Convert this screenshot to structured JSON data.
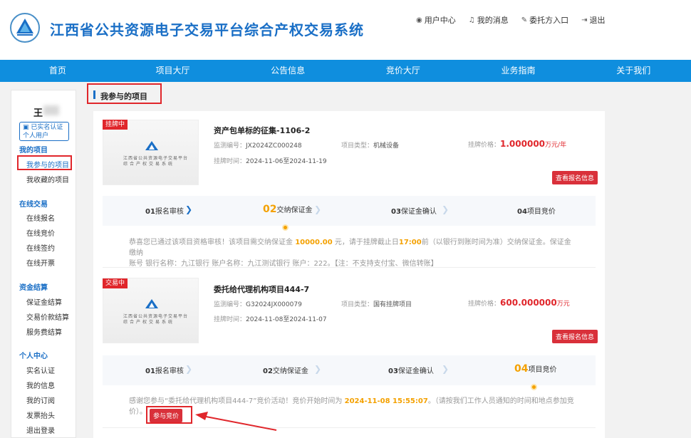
{
  "header": {
    "site_title": "江西省公共资源电子交易平台综合产权交易系统",
    "links": [
      {
        "icon": "user-icon",
        "label": "用户中心"
      },
      {
        "icon": "bell-icon",
        "label": "我的消息"
      },
      {
        "icon": "delegate-icon",
        "label": "委托方入口"
      },
      {
        "icon": "logout-icon",
        "label": "退出"
      }
    ]
  },
  "nav": [
    "首页",
    "项目大厅",
    "公告信息",
    "竞价大厅",
    "业务指南",
    "关于我们"
  ],
  "sidebar": {
    "user_name": "王",
    "badge_line1": "已实名认证",
    "badge_line2": "个人用户",
    "sections": [
      {
        "title": "我的项目",
        "items": [
          "我参与的项目",
          "我收藏的项目"
        ]
      },
      {
        "title": "在线交易",
        "items": [
          "在线报名",
          "在线竞价",
          "在线签约",
          "在线开票"
        ]
      },
      {
        "title": "资金结算",
        "items": [
          "保证金结算",
          "交易价款结算",
          "服务费结算"
        ]
      },
      {
        "title": "个人中心",
        "items": [
          "实名认证",
          "我的信息",
          "我的订阅",
          "发票抬头",
          "退出登录"
        ]
      }
    ]
  },
  "main": {
    "section_title": "我参与的项目",
    "thumb_text1": "江西省公共资源电子交易平台",
    "thumb_text2": "综合产权交易系统",
    "projects": [
      {
        "tag": "挂牌中",
        "title": "资产包单标的征集-1106-2",
        "code_label": "监测编号：",
        "code": "JX2024ZC000248",
        "type_label": "项目类型：",
        "type": "机械设备",
        "price_label": "挂牌价格：",
        "price": "1.000000",
        "unit": "万元/年",
        "time_label": "挂牌时间：",
        "time": "2024-11-06至2024-11-19",
        "view_button": "查看报名信息",
        "steps": [
          {
            "num": "01",
            "label": "报名审核"
          },
          {
            "num": "02",
            "label": "交纳保证金"
          },
          {
            "num": "03",
            "label": "保证金确认"
          },
          {
            "num": "04",
            "label": "项目竞价"
          }
        ],
        "active_step": 2,
        "msg_a": "恭喜您已通过该项目资格审核！该项目需交纳保证金 ",
        "msg_amount": "10000.00",
        "msg_b": " 元，请于挂牌截止日",
        "msg_time": "17:00",
        "msg_c": "前（以银行到账时间为准）交纳保证金。保证金缴纳",
        "msg_line2": "账号  银行名称：九江银行 账户名称：九江测试银行 账户：222。【注：不支持支付宝、微信转账】"
      },
      {
        "tag": "交易中",
        "title": "委托给代理机构项目444-7",
        "code_label": "监测编号：",
        "code": "G32024JX000079",
        "type_label": "项目类型：",
        "type": "国有挂牌项目",
        "price_label": "挂牌价格：",
        "price": "600.000000",
        "unit": "万元",
        "time_label": "挂牌时间：",
        "time": "2024-11-08至2024-11-07",
        "view_button": "查看报名信息",
        "steps": [
          {
            "num": "01",
            "label": "报名审核"
          },
          {
            "num": "02",
            "label": "交纳保证金"
          },
          {
            "num": "03",
            "label": "保证金确认"
          },
          {
            "num": "04",
            "label": "项目竞价"
          }
        ],
        "active_step": 4,
        "msg_a": "感谢您参与“委托给代理机构项目444-7”竞价活动！竞价开始时间为 ",
        "msg_time": "2024-11-08 15:55:07",
        "msg_b": "。（请按我们工作人员通知的时间和地点参加竞",
        "msg_line2": "价）。",
        "bid_button": "参与竞价"
      }
    ]
  },
  "colors": {
    "brand": "#1a6fc6",
    "nav": "#0f8ede",
    "accent": "#f4a100",
    "danger": "#e0262b"
  }
}
